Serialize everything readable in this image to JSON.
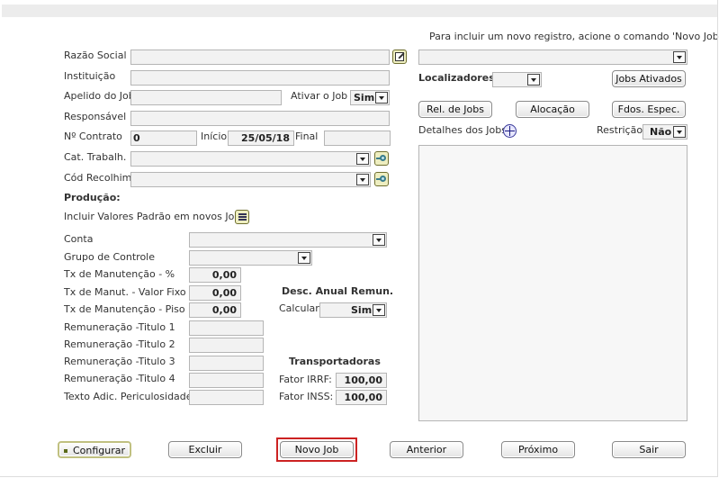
{
  "info_text": "Para incluir um novo registro, acione o comando 'Novo Job'.",
  "form": {
    "razao_social_label": "Razão Social",
    "instituicao_label": "Instituição",
    "apelido_label": "Apelido do Job",
    "ativar_label": "Ativar o Job",
    "ativar_value": "Sim",
    "responsavel_label": "Responsável",
    "contrato_label": "Nº Contrato",
    "contrato_value": "0",
    "inicio_label": "Início",
    "inicio_value": "25/05/18",
    "final_label": "Final",
    "cat_label": "Cat. Trabalh.",
    "cod_label": "Cód Recolhim."
  },
  "producao": {
    "title": "Produção:",
    "incluir_label": "Incluir Valores Padrão em novos Jobs",
    "conta_label": "Conta",
    "grupo_label": "Grupo de Controle",
    "tx_manut_label": "Tx de Manutenção - %",
    "tx_manut_value": "0,00",
    "tx_fixo_label": "Tx de Manut. - Valor Fixo $:",
    "tx_fixo_value": "0,00",
    "tx_piso_label": "Tx de Manutenção - Piso",
    "tx_piso_value": "0,00",
    "rem1_label": "Remuneração -Titulo 1",
    "rem2_label": "Remuneração -Titulo 2",
    "rem3_label": "Remuneração -Titulo 3",
    "rem4_label": "Remuneração -Titulo 4",
    "texto_label": "Texto Adic. Periculosidade"
  },
  "desc_anual": {
    "title": "Desc. Anual Remun.",
    "calcular_label": "Calcular",
    "calcular_value": "Sim"
  },
  "transportadoras": {
    "title": "Transportadoras",
    "irrf_label": "Fator IRRF:",
    "irrf_value": "100,00",
    "inss_label": "Fator INSS:",
    "inss_value": "100,00"
  },
  "right": {
    "localizadores_label": "Localizadores",
    "jobs_ativados_label": "Jobs Ativados",
    "rel_jobs_label": "Rel. de Jobs",
    "alocacao_label": "Alocação",
    "fdos_label": "Fdos. Espec.",
    "detalhes_label": "Detalhes dos Jobs",
    "restricao_label": "Restrição",
    "restricao_value": "Não"
  },
  "footer": {
    "configurar": "Configurar",
    "excluir": "Excluir",
    "novo_job": "Novo Job",
    "anterior": "Anterior",
    "proximo": "Próximo",
    "sair": "Sair"
  },
  "colors": {
    "highlight": "#cc2222",
    "field_bg": "#f2f2f2",
    "icon_bg": "#eeeec0"
  }
}
